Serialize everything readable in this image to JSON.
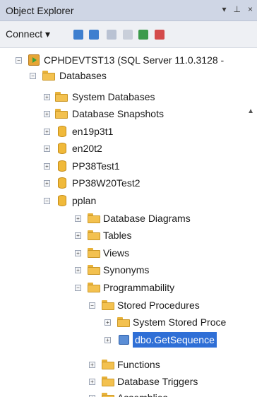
{
  "panel": {
    "title": "Object Explorer",
    "pin_icon": "pin-icon",
    "close_glyph": "×",
    "dropdown_glyph": "▾"
  },
  "toolbar": {
    "connect_label": "Connect ▾"
  },
  "tree": {
    "server_label": "CPHDEVTST13 (SQL Server 11.0.3128 - ",
    "databases_label": "Databases",
    "system_databases": "System Databases",
    "database_snapshots": "Database Snapshots",
    "db1": "en19p3t1",
    "db2": "en20t2",
    "db3": "PP38Test1",
    "db4": "PP38W20Test2",
    "db5": "pplan",
    "database_diagrams": "Database Diagrams",
    "tables": "Tables",
    "views": "Views",
    "synonyms": "Synonyms",
    "programmability": "Programmability",
    "stored_procedures": "Stored Procedures",
    "system_stored_procedures": "System Stored Proce",
    "sp_selected": "dbo.GetSequence",
    "functions": "Functions",
    "database_triggers": "Database Triggers",
    "assemblies": "Assemblies"
  },
  "colors": {
    "selection": "#2f6fd6",
    "folder": "#f3c14f",
    "titlebar": "#cfd6e5"
  }
}
